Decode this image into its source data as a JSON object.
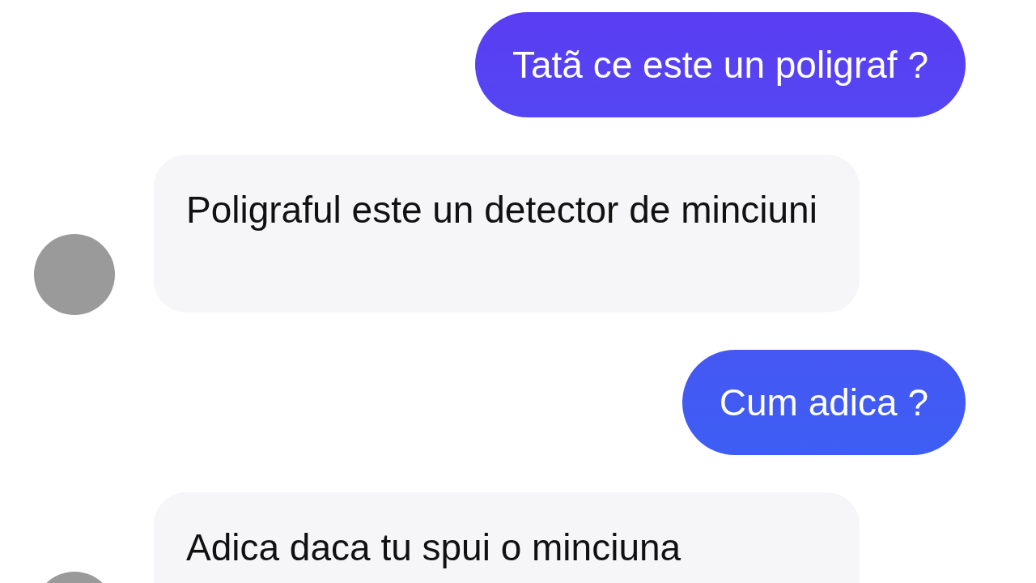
{
  "messages": [
    {
      "kind": "sent",
      "text": "Tatã ce este un poligraf ?"
    },
    {
      "kind": "received",
      "text": "Poligraful este un detector de minciuni"
    },
    {
      "kind": "sent",
      "text": "Cum adica ?"
    },
    {
      "kind": "received",
      "text": "Adica daca tu spui o minciuna"
    }
  ]
}
